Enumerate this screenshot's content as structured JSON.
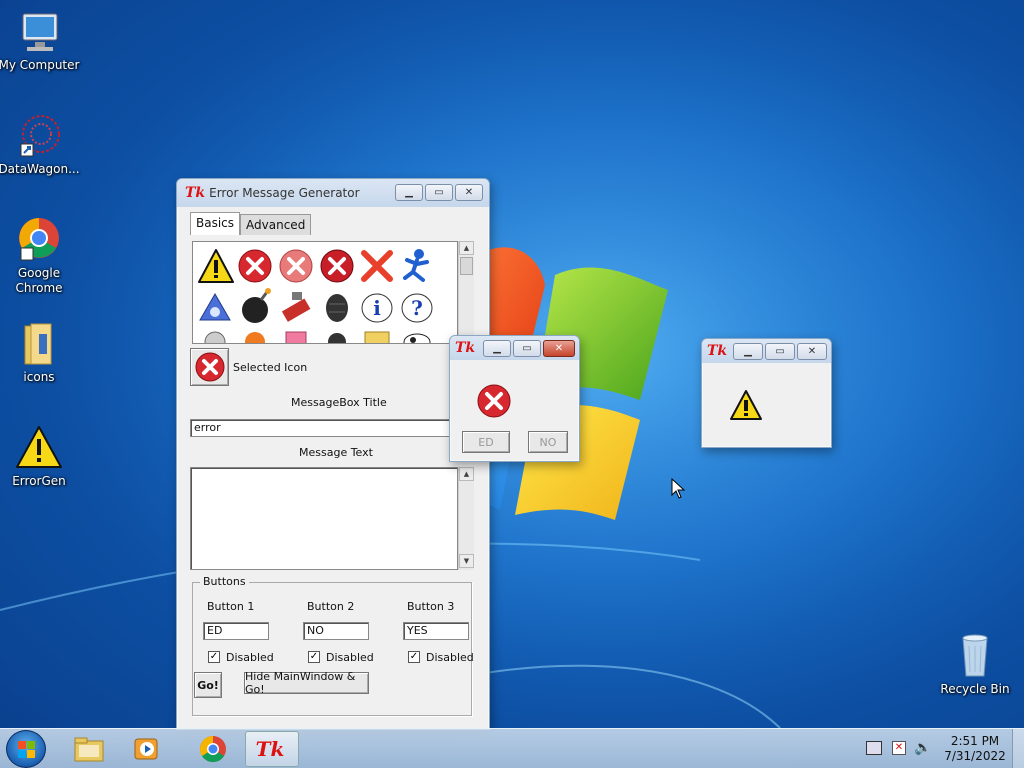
{
  "desktop": {
    "icons": [
      {
        "label": "My Computer"
      },
      {
        "label": "DataWagon..."
      },
      {
        "label": "Google Chrome"
      },
      {
        "label": "icons"
      },
      {
        "label": "ErrorGen"
      },
      {
        "label": "Recycle Bin"
      }
    ]
  },
  "main_window": {
    "title": "Error Message Generator",
    "tk_logo": "Tk",
    "tabs": [
      "Basics",
      "Advanced"
    ],
    "selected_icon_label": "Selected Icon",
    "messagebox_title_label": "MessageBox Title",
    "messagebox_title_value": "error",
    "message_text_label": "Message Text",
    "message_text_value": "",
    "buttons_group_label": "Buttons",
    "button1_label": "Button 1",
    "button2_label": "Button 2",
    "button3_label": "Button 3",
    "button1_value": "ED",
    "button2_value": "NO",
    "button3_value": "YES",
    "disabled_label": "Disabled",
    "disabled_checked": [
      true,
      true,
      true
    ],
    "go_label": "Go!",
    "hide_go_label": "Hide MainWindow & Go!"
  },
  "popup_error": {
    "tk_logo": "Tk",
    "btn1": "ED",
    "btn2": "NO"
  },
  "popup_warning": {
    "tk_logo": "Tk"
  },
  "taskbar": {
    "time": "2:51 PM",
    "date": "7/31/2022",
    "tk_logo": "Tk"
  },
  "colors": {
    "error_red": "#d7282f",
    "warning_yellow": "#f6d816"
  }
}
